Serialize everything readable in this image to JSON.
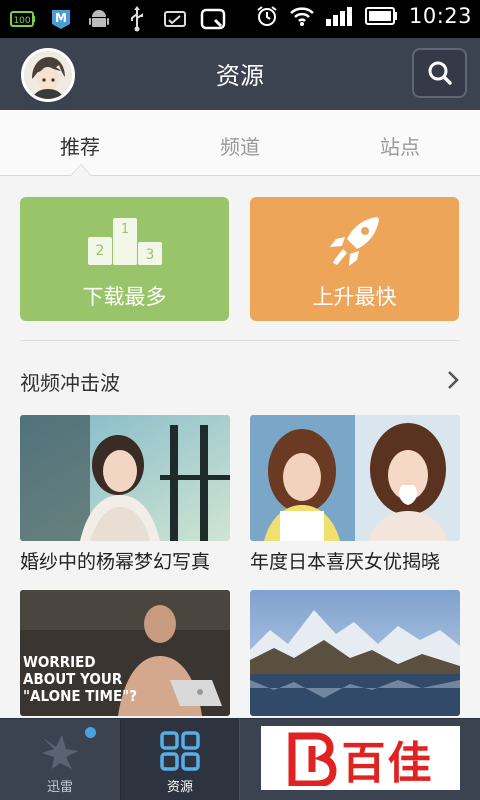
{
  "status_bar": {
    "time": "10:23",
    "battery_label": "100",
    "icons": [
      "battery-full-icon",
      "app-m-icon",
      "android-icon",
      "usb-icon",
      "sd-card-icon",
      "q-app-icon",
      "alarm-icon",
      "wifi-icon",
      "signal-icon",
      "battery-icon"
    ]
  },
  "header": {
    "title": "资源",
    "avatar": "avatar",
    "search_icon": "search-icon"
  },
  "tabs": [
    {
      "label": "推荐",
      "active": true
    },
    {
      "label": "频道",
      "active": false
    },
    {
      "label": "站点",
      "active": false
    }
  ],
  "feature_cards": [
    {
      "label": "下载最多",
      "icon": "podium-icon",
      "color": "#9ac46a",
      "podium": [
        "1",
        "2",
        "3"
      ]
    },
    {
      "label": "上升最快",
      "icon": "rocket-icon",
      "color": "#eda55a"
    }
  ],
  "section": {
    "title": "视频冲击波",
    "more_icon": "chevron-right-icon"
  },
  "videos": [
    {
      "caption": "婚纱中的杨幂梦幻写真"
    },
    {
      "caption": "年度日本喜厌女优揭晓"
    },
    {
      "caption": "",
      "overlay_lines": [
        "WORRIED",
        "ABOUT YOUR",
        "\"ALONE TIME\"?"
      ]
    },
    {
      "caption": ""
    }
  ],
  "bottom_nav": [
    {
      "label": "迅雷",
      "icon": "xunlei-bird-icon",
      "active": false,
      "badge": true
    },
    {
      "label": "资源",
      "icon": "grid-icon",
      "active": true
    }
  ],
  "ad": {
    "text": "百佳"
  },
  "colors": {
    "header_bg": "#3b4250",
    "green_card": "#9ac46a",
    "orange_card": "#eda55a",
    "badge_blue": "#4aa3e0",
    "ad_red": "#e02222"
  }
}
